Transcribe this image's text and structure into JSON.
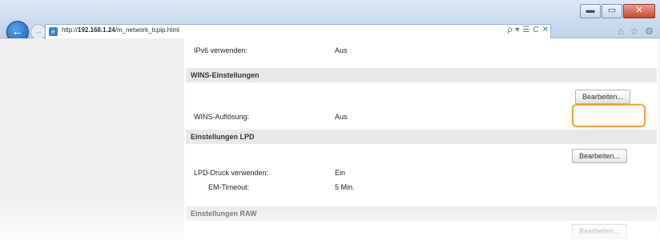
{
  "browser": {
    "address_prefix": "http://",
    "address_host": "192.168.1.24",
    "address_path": "/m_network_tcpip.html",
    "tools": [
      "ρ",
      "▾",
      "☰",
      "C",
      "✕"
    ],
    "window_buttons": [
      "▬",
      "▭",
      "✕"
    ]
  },
  "settings": {
    "ipv6": {
      "label": "IPv6 verwenden:",
      "value": "Aus"
    },
    "wins": {
      "header": "WINS-Einstellungen",
      "edit_label": "Bearbeiten...",
      "resolution": {
        "label": "WINS-Auflösung:",
        "value": "Aus"
      }
    },
    "lpd": {
      "header": "Einstellungen LPD",
      "edit_label": "Bearbeiten...",
      "print": {
        "label": "LPD-Druck verwenden:",
        "value": "Ein"
      },
      "timeout": {
        "label": "EM-Timeout:",
        "value": "5 Min."
      }
    },
    "raw": {
      "header": "Einstellungen RAW",
      "edit_label": "Bearbeiten..."
    }
  }
}
